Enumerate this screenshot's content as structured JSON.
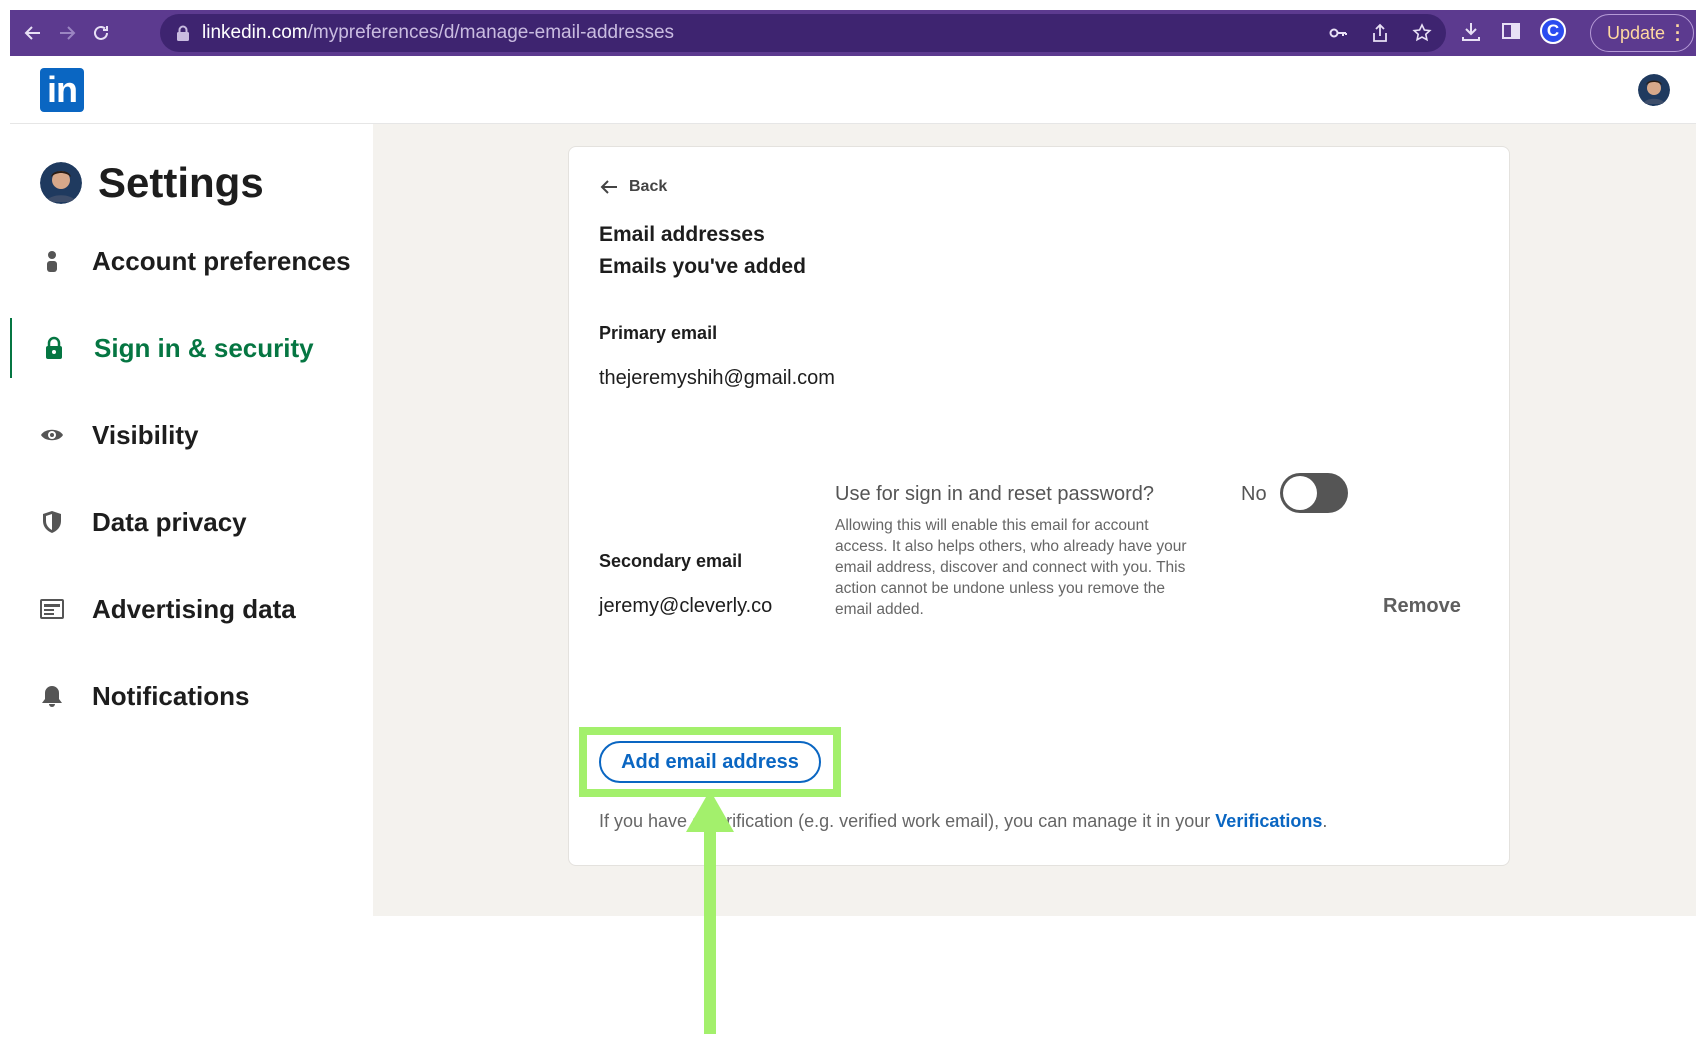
{
  "browser": {
    "url_domain": "linkedin.com",
    "url_path": "/mypreferences/d/manage-email-addresses",
    "update_label": "Update",
    "profile_letter": "C"
  },
  "header": {
    "logo_text": "in"
  },
  "sidebar": {
    "title": "Settings",
    "items": [
      {
        "label": "Account preferences",
        "icon": "person-icon"
      },
      {
        "label": "Sign in & security",
        "icon": "lock-icon",
        "active": true
      },
      {
        "label": "Visibility",
        "icon": "eye-icon"
      },
      {
        "label": "Data privacy",
        "icon": "shield-icon"
      },
      {
        "label": "Advertising data",
        "icon": "ad-icon"
      },
      {
        "label": "Notifications",
        "icon": "bell-icon"
      }
    ]
  },
  "card": {
    "back_label": "Back",
    "title": "Email addresses",
    "subtitle": "Emails you've added",
    "primary_label": "Primary email",
    "primary_email": "thejeremyshih@gmail.com",
    "signin_question": "Use for sign in and reset password?",
    "signin_description": "Allowing this will enable this email for account access. It also helps others, who already have your email address, discover and connect with you. This action cannot be undone unless you remove the email added.",
    "toggle_state": "No",
    "secondary_label": "Secondary email",
    "secondary_email": "jeremy@cleverly.co",
    "remove_label": "Remove",
    "add_button_label": "Add email address",
    "footer_note_prefix": "If you have a verification (e.g. verified work email), you can manage it in your ",
    "footer_link": "Verifications",
    "footer_suffix": "."
  },
  "colors": {
    "browser_bar": "#5c3a8f",
    "linkedin_blue": "#0a66c2",
    "active_green": "#057642",
    "highlight_green": "#a3f06c"
  }
}
